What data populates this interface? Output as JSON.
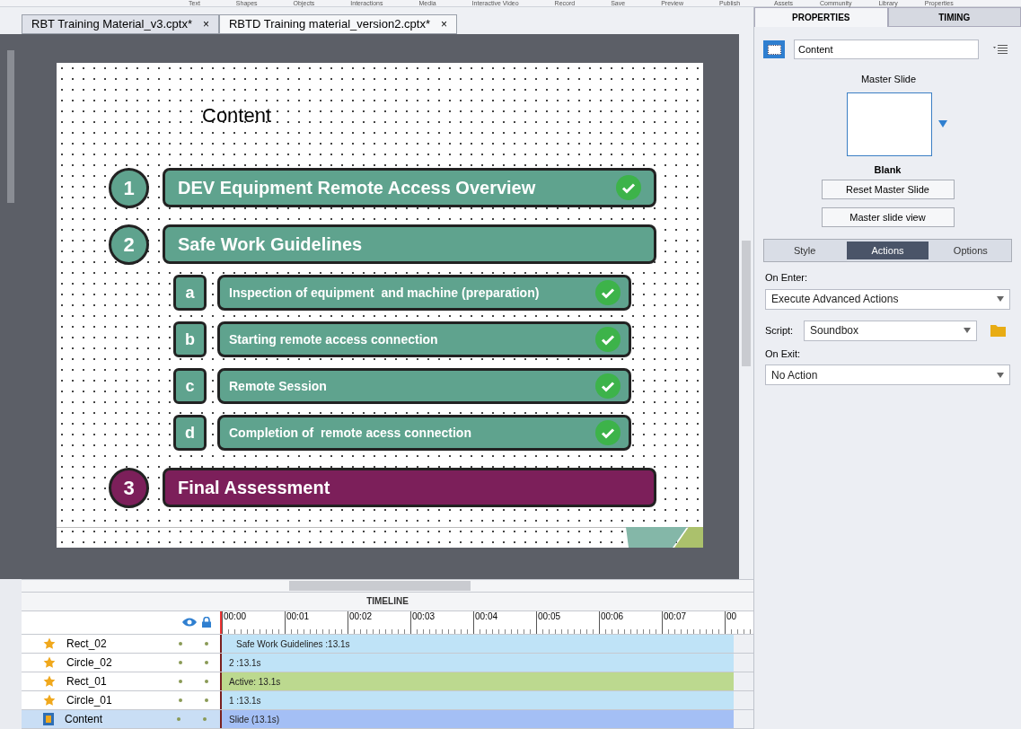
{
  "toolbar": {
    "left": [
      "Text",
      "Shapes",
      "Objects",
      "Interactions",
      "Media",
      "Interactive Video",
      "Record",
      "Save",
      "Preview",
      "Publish"
    ],
    "right": [
      "Assets",
      "Community",
      "Library",
      "Properties"
    ]
  },
  "tabs": [
    {
      "label": "RBT Training Material_v3.cptx*",
      "close": "×",
      "selected": true
    },
    {
      "label": "RBTD Training material_version2.cptx*",
      "close": "×",
      "selected": false
    }
  ],
  "slide": {
    "title": "Content",
    "items": [
      {
        "number": "1",
        "label": "DEV Equipment Remote Access Overview",
        "color": "#5fa38e",
        "checked": true
      },
      {
        "number": "2",
        "label": "Safe Work Guidelines",
        "color": "#5fa38e",
        "checked": false,
        "children": [
          {
            "number": "a",
            "label": "Inspection of equipment  and machine (preparation)",
            "color": "#5fa38e",
            "checked": true
          },
          {
            "number": "b",
            "label": "Starting remote access connection",
            "color": "#5fa38e",
            "checked": true
          },
          {
            "number": "c",
            "label": "Remote Session",
            "color": "#5fa38e",
            "checked": true
          },
          {
            "number": "d",
            "label": "Completion of  remote acess connection",
            "color": "#5fa38e",
            "checked": true
          }
        ]
      },
      {
        "number": "3",
        "label": "Final Assessment",
        "color": "#7c1f5a",
        "checked": false
      }
    ]
  },
  "timeline": {
    "title": "TIMELINE",
    "ticks": [
      "00:00",
      "00:01",
      "00:02",
      "00:03",
      "00:04",
      "00:05",
      "00:06",
      "00:07",
      "00"
    ],
    "rows": [
      {
        "name": "Rect_02",
        "kind": "object",
        "bar": "Safe Work Guidelines :13.1s",
        "color": "#bfe3f7",
        "selected": false
      },
      {
        "name": "Circle_02",
        "kind": "object",
        "bar": "2 :13.1s",
        "color": "#bfe3f7",
        "selected": false
      },
      {
        "name": "Rect_01",
        "kind": "object",
        "bar": "Active: 13.1s",
        "color": "#bcd98f",
        "selected": false
      },
      {
        "name": "Circle_01",
        "kind": "object",
        "bar": "1 :13.1s",
        "color": "#bfe3f7",
        "selected": false
      },
      {
        "name": "Content",
        "kind": "slide",
        "bar": "Slide (13.1s)",
        "color": "#a4bff5",
        "selected": true
      }
    ]
  },
  "panel": {
    "tabs": [
      {
        "label": "PROPERTIES",
        "selected": true
      },
      {
        "label": "TIMING",
        "selected": false
      }
    ],
    "name_value": "Content",
    "master_label": "Master Slide",
    "master_name": "Blank",
    "buttons": [
      "Reset Master Slide",
      "Master slide view"
    ],
    "subtabs": [
      {
        "label": "Style",
        "selected": false
      },
      {
        "label": "Actions",
        "selected": true
      },
      {
        "label": "Options",
        "selected": false
      }
    ],
    "on_enter": {
      "label": "On Enter:",
      "value": "Execute Advanced Actions"
    },
    "script": {
      "label": "Script:",
      "value": "Soundbox"
    },
    "on_exit": {
      "label": "On Exit:",
      "value": "No Action"
    }
  }
}
